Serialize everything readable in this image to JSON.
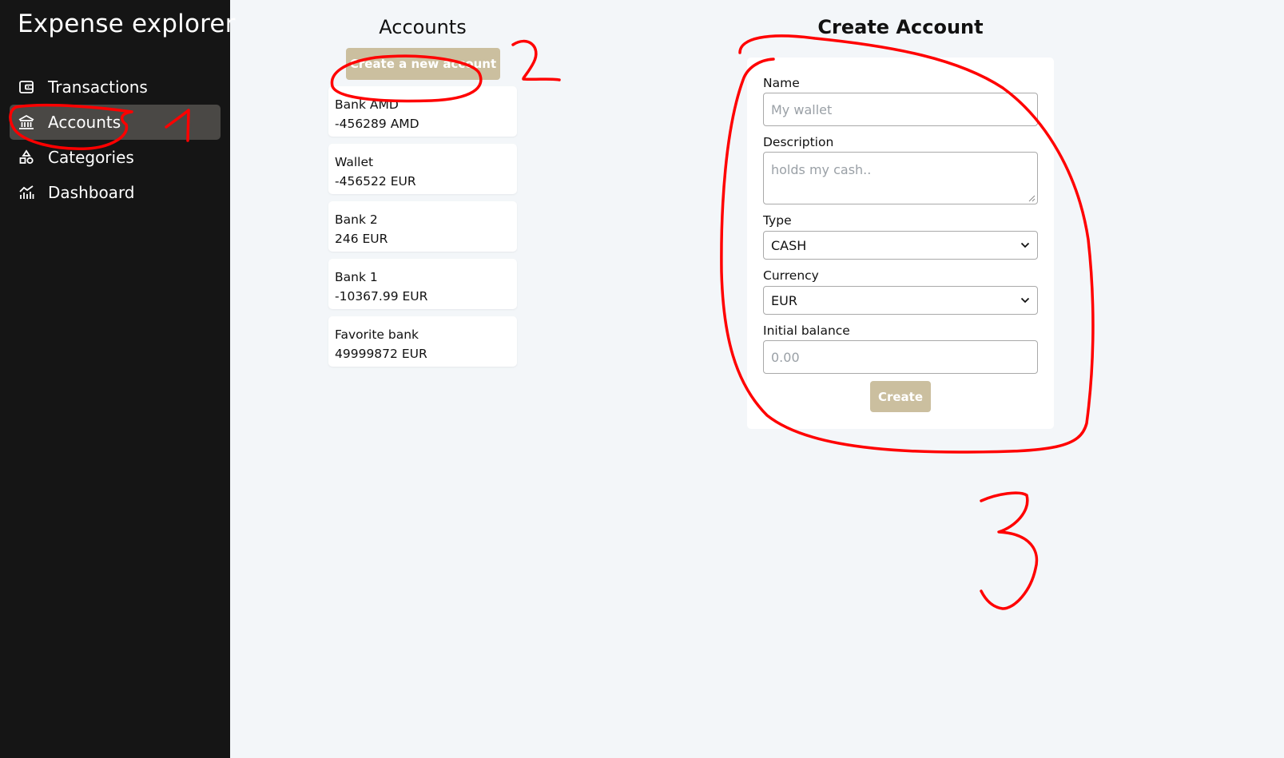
{
  "app": {
    "title": "Expense explorer"
  },
  "sidebar": {
    "items": [
      {
        "label": "Transactions",
        "icon": "wallet-icon",
        "active": false
      },
      {
        "label": "Accounts",
        "icon": "bank-icon",
        "active": true
      },
      {
        "label": "Categories",
        "icon": "shapes-icon",
        "active": false
      },
      {
        "label": "Dashboard",
        "icon": "chart-icon",
        "active": false
      }
    ]
  },
  "accounts": {
    "title": "Accounts",
    "new_button_label": "Create a new account",
    "list": [
      {
        "name": "Bank AMD",
        "balance": "-456289 AMD"
      },
      {
        "name": "Wallet",
        "balance": "-456522 EUR"
      },
      {
        "name": "Bank 2",
        "balance": "246 EUR"
      },
      {
        "name": "Bank 1",
        "balance": "-10367.99 EUR"
      },
      {
        "name": "Favorite bank",
        "balance": "49999872 EUR"
      }
    ]
  },
  "create_form": {
    "title": "Create Account",
    "name_label": "Name",
    "name_placeholder": "My wallet",
    "description_label": "Description",
    "description_placeholder": "holds my cash..",
    "type_label": "Type",
    "type_value": "CASH",
    "currency_label": "Currency",
    "currency_value": "EUR",
    "balance_label": "Initial balance",
    "balance_placeholder": "0.00",
    "submit_label": "Create"
  },
  "annotations": {
    "color": "#ff0000",
    "marks": [
      "1",
      "2",
      "3"
    ]
  },
  "colors": {
    "sidebar_bg": "#151515",
    "active_item_bg": "#4a4845",
    "accent_button": "#cbbf9f",
    "page_bg": "#f3f6f9"
  }
}
